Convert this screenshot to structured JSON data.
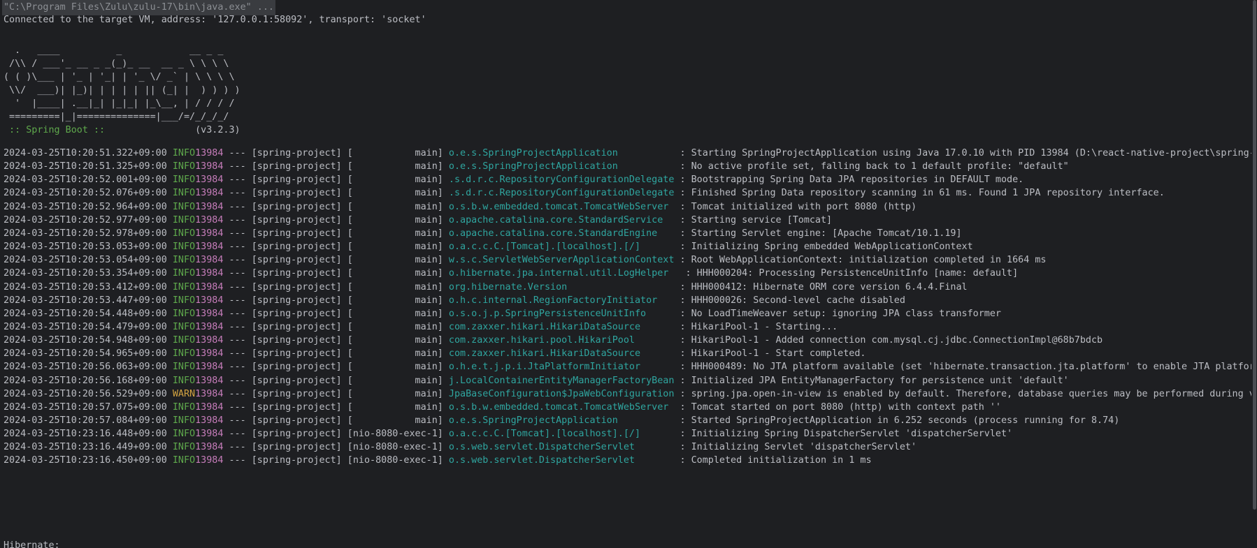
{
  "command": "\"C:\\Program Files\\Zulu\\zulu-17\\bin\\java.exe\" ...",
  "connected": "Connected to the target VM, address: '127.0.0.1:58092', transport: 'socket'",
  "banner": [
    "  .   ____          _            __ _ _",
    " /\\\\ / ___'_ __ _ _(_)_ __  __ _ \\ \\ \\ \\",
    "( ( )\\___ | '_ | '_| | '_ \\/ _` | \\ \\ \\ \\",
    " \\\\/  ___)| |_)| | | | | || (_| |  ) ) ) )",
    "  '  |____| .__|_| |_|_| |_\\__, | / / / /",
    " =========|_|==============|___/=/_/_/_/"
  ],
  "spring_label": " :: Spring Boot :: ",
  "spring_version": "               (v3.2.3)",
  "logs": [
    {
      "ts": "2024-03-25T10:20:51.322+09:00",
      "level": " INFO",
      "pid": "13984",
      "mid": " --- [spring-project] [           main] ",
      "logger": "o.e.s.SpringProjectApplication          ",
      "msg": " : Starting SpringProjectApplication using Java 17.0.10 with PID 13984 (D:\\react-native-project\\spring-"
    },
    {
      "ts": "2024-03-25T10:20:51.325+09:00",
      "level": " INFO",
      "pid": "13984",
      "mid": " --- [spring-project] [           main] ",
      "logger": "o.e.s.SpringProjectApplication          ",
      "msg": " : No active profile set, falling back to 1 default profile: \"default\""
    },
    {
      "ts": "2024-03-25T10:20:52.001+09:00",
      "level": " INFO",
      "pid": "13984",
      "mid": " --- [spring-project] [           main] ",
      "logger": ".s.d.r.c.RepositoryConfigurationDelegate",
      "msg": " : Bootstrapping Spring Data JPA repositories in DEFAULT mode."
    },
    {
      "ts": "2024-03-25T10:20:52.076+09:00",
      "level": " INFO",
      "pid": "13984",
      "mid": " --- [spring-project] [           main] ",
      "logger": ".s.d.r.c.RepositoryConfigurationDelegate",
      "msg": " : Finished Spring Data repository scanning in 61 ms. Found 1 JPA repository interface."
    },
    {
      "ts": "2024-03-25T10:20:52.964+09:00",
      "level": " INFO",
      "pid": "13984",
      "mid": " --- [spring-project] [           main] ",
      "logger": "o.s.b.w.embedded.tomcat.TomcatWebServer ",
      "msg": " : Tomcat initialized with port 8080 (http)"
    },
    {
      "ts": "2024-03-25T10:20:52.977+09:00",
      "level": " INFO",
      "pid": "13984",
      "mid": " --- [spring-project] [           main] ",
      "logger": "o.apache.catalina.core.StandardService  ",
      "msg": " : Starting service [Tomcat]"
    },
    {
      "ts": "2024-03-25T10:20:52.978+09:00",
      "level": " INFO",
      "pid": "13984",
      "mid": " --- [spring-project] [           main] ",
      "logger": "o.apache.catalina.core.StandardEngine   ",
      "msg": " : Starting Servlet engine: [Apache Tomcat/10.1.19]"
    },
    {
      "ts": "2024-03-25T10:20:53.053+09:00",
      "level": " INFO",
      "pid": "13984",
      "mid": " --- [spring-project] [           main] ",
      "logger": "o.a.c.c.C.[Tomcat].[localhost].[/]      ",
      "msg": " : Initializing Spring embedded WebApplicationContext"
    },
    {
      "ts": "2024-03-25T10:20:53.054+09:00",
      "level": " INFO",
      "pid": "13984",
      "mid": " --- [spring-project] [           main] ",
      "logger": "w.s.c.ServletWebServerApplicationContext",
      "msg": " : Root WebApplicationContext: initialization completed in 1664 ms"
    },
    {
      "ts": "2024-03-25T10:20:53.354+09:00",
      "level": " INFO",
      "pid": "13984",
      "mid": " --- [spring-project] [           main] ",
      "logger": "o.hibernate.jpa.internal.util.LogHelper  ",
      "msg": " : HHH000204: Processing PersistenceUnitInfo [name: default]"
    },
    {
      "ts": "2024-03-25T10:20:53.412+09:00",
      "level": " INFO",
      "pid": "13984",
      "mid": " --- [spring-project] [           main] ",
      "logger": "org.hibernate.Version                   ",
      "msg": " : HHH000412: Hibernate ORM core version 6.4.4.Final"
    },
    {
      "ts": "2024-03-25T10:20:53.447+09:00",
      "level": " INFO",
      "pid": "13984",
      "mid": " --- [spring-project] [           main] ",
      "logger": "o.h.c.internal.RegionFactoryInitiator   ",
      "msg": " : HHH000026: Second-level cache disabled"
    },
    {
      "ts": "2024-03-25T10:20:54.448+09:00",
      "level": " INFO",
      "pid": "13984",
      "mid": " --- [spring-project] [           main] ",
      "logger": "o.s.o.j.p.SpringPersistenceUnitInfo     ",
      "msg": " : No LoadTimeWeaver setup: ignoring JPA class transformer"
    },
    {
      "ts": "2024-03-25T10:20:54.479+09:00",
      "level": " INFO",
      "pid": "13984",
      "mid": " --- [spring-project] [           main] ",
      "logger": "com.zaxxer.hikari.HikariDataSource      ",
      "msg": " : HikariPool-1 - Starting..."
    },
    {
      "ts": "2024-03-25T10:20:54.948+09:00",
      "level": " INFO",
      "pid": "13984",
      "mid": " --- [spring-project] [           main] ",
      "logger": "com.zaxxer.hikari.pool.HikariPool       ",
      "msg": " : HikariPool-1 - Added connection com.mysql.cj.jdbc.ConnectionImpl@68b7bdcb"
    },
    {
      "ts": "2024-03-25T10:20:54.965+09:00",
      "level": " INFO",
      "pid": "13984",
      "mid": " --- [spring-project] [           main] ",
      "logger": "com.zaxxer.hikari.HikariDataSource      ",
      "msg": " : HikariPool-1 - Start completed."
    },
    {
      "ts": "2024-03-25T10:20:56.063+09:00",
      "level": " INFO",
      "pid": "13984",
      "mid": " --- [spring-project] [           main] ",
      "logger": "o.h.e.t.j.p.i.JtaPlatformInitiator      ",
      "msg": " : HHH000489: No JTA platform available (set 'hibernate.transaction.jta.platform' to enable JTA platfor"
    },
    {
      "ts": "2024-03-25T10:20:56.168+09:00",
      "level": " INFO",
      "pid": "13984",
      "mid": " --- [spring-project] [           main] ",
      "logger": "j.LocalContainerEntityManagerFactoryBean",
      "msg": " : Initialized JPA EntityManagerFactory for persistence unit 'default'"
    },
    {
      "ts": "2024-03-25T10:20:56.529+09:00",
      "level": " WARN",
      "pid": "13984",
      "mid": " --- [spring-project] [           main] ",
      "logger": "JpaBaseConfiguration$JpaWebConfiguration",
      "msg": " : spring.jpa.open-in-view is enabled by default. Therefore, database queries may be performed during v"
    },
    {
      "ts": "2024-03-25T10:20:57.075+09:00",
      "level": " INFO",
      "pid": "13984",
      "mid": " --- [spring-project] [           main] ",
      "logger": "o.s.b.w.embedded.tomcat.TomcatWebServer ",
      "msg": " : Tomcat started on port 8080 (http) with context path ''"
    },
    {
      "ts": "2024-03-25T10:20:57.084+09:00",
      "level": " INFO",
      "pid": "13984",
      "mid": " --- [spring-project] [           main] ",
      "logger": "o.e.s.SpringProjectApplication          ",
      "msg": " : Started SpringProjectApplication in 6.252 seconds (process running for 8.74)"
    },
    {
      "ts": "2024-03-25T10:23:16.448+09:00",
      "level": " INFO",
      "pid": "13984",
      "mid": " --- [spring-project] [nio-8080-exec-1] ",
      "logger": "o.a.c.c.C.[Tomcat].[localhost].[/]      ",
      "msg": " : Initializing Spring DispatcherServlet 'dispatcherServlet'"
    },
    {
      "ts": "2024-03-25T10:23:16.449+09:00",
      "level": " INFO",
      "pid": "13984",
      "mid": " --- [spring-project] [nio-8080-exec-1] ",
      "logger": "o.s.web.servlet.DispatcherServlet       ",
      "msg": " : Initializing Servlet 'dispatcherServlet'"
    },
    {
      "ts": "2024-03-25T10:23:16.450+09:00",
      "level": " INFO",
      "pid": "13984",
      "mid": " --- [spring-project] [nio-8080-exec-1] ",
      "logger": "o.s.web.servlet.DispatcherServlet       ",
      "msg": " : Completed initialization in 1 ms"
    }
  ],
  "trailing": "Hibernate:"
}
